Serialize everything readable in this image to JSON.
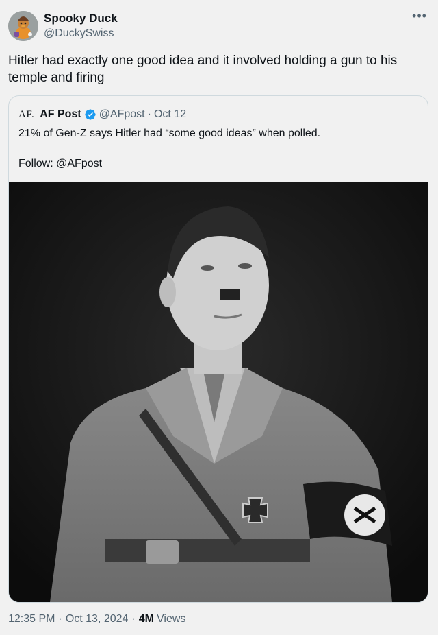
{
  "author": {
    "display_name": "Spooky Duck",
    "handle": "@DuckySwiss"
  },
  "more_icon": "ellipsis-icon",
  "tweet": {
    "text": "Hitler had exactly one good idea and it involved holding a gun to his temple and firing"
  },
  "quoted": {
    "logo_text": "AF.",
    "display_name": "AF Post",
    "verified_icon": "verified-badge-icon",
    "handle": "@AFpost",
    "separator": "·",
    "date": "Oct 12",
    "text": "21% of Gen-Z says Hitler had “some good ideas” when polled.\n\nFollow: @AFpost"
  },
  "footer": {
    "time": "12:35 PM",
    "separator": "·",
    "date": "Oct 13, 2024",
    "separator2": "·",
    "views_count": "4M",
    "views_label": "Views"
  },
  "colors": {
    "background": "#f1f1f1",
    "verified": "#1d9bf0",
    "secondary_text": "#536471"
  }
}
